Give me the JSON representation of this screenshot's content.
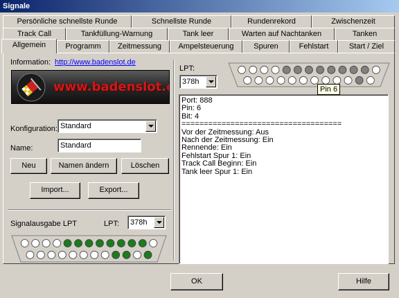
{
  "window": {
    "title": "Signale"
  },
  "tabs": {
    "row1": [
      "Persönliche schnellste Runde",
      "Schnellste Runde",
      "Rundenrekord",
      "Zwischenzeit"
    ],
    "row2": [
      "Track Call",
      "Tankfüllung-Warnung",
      "Tank leer",
      "Warten auf Nachtanken",
      "Tanken"
    ],
    "row3": [
      "Allgemein",
      "Programm",
      "Zeitmessung",
      "Ampelsteuerung",
      "Spuren",
      "Fehlstart",
      "Start / Ziel"
    ],
    "active": "Allgemein"
  },
  "info": {
    "label": "Information:",
    "url": "http://www.badenslot.de",
    "logo_text": "www.badenslot.de"
  },
  "konfiguration": {
    "label": "Konfiguration:",
    "value": "Standard"
  },
  "name": {
    "label": "Name:",
    "value": "Standard"
  },
  "buttons": {
    "neu": "Neu",
    "namen_aendern": "Namen ändern",
    "loeschen": "Löschen",
    "import": "Import...",
    "export": "Export...",
    "ok": "OK",
    "hilfe": "Hilfe"
  },
  "signalausgabe": {
    "label": "Signalausgabe LPT",
    "lpt_label": "LPT:",
    "lpt_value": "378h",
    "top_pins": [
      "off",
      "off",
      "off",
      "off",
      "on",
      "on",
      "on",
      "on",
      "on",
      "on",
      "on",
      "on",
      "off"
    ],
    "bottom_pins": [
      "off",
      "off",
      "off",
      "off",
      "off",
      "off",
      "off",
      "off",
      "on",
      "on",
      "off",
      "on"
    ],
    "on_color": "#1e7a1e",
    "off_color": "#ffffff"
  },
  "lpt_monitor": {
    "label": "LPT:",
    "value": "378h",
    "top_pins": [
      "off",
      "off",
      "off",
      "off",
      "on",
      "on",
      "on",
      "on",
      "on",
      "on",
      "on",
      "on",
      "off"
    ],
    "bottom_pins": [
      "off",
      "off",
      "off",
      "off",
      "off",
      "off",
      "off",
      "off",
      "off",
      "off",
      "on",
      "off"
    ],
    "on_color": "#808080",
    "off_color": "#ffffff",
    "tooltip": "Pin 6"
  },
  "log": {
    "lines": [
      "Port: 888",
      "Pin: 6",
      "Bit: 4",
      "====================================",
      "Vor der Zeitmessung: Aus",
      "Nach der Zeitmessung: Ein",
      "Rennende: Ein",
      "Fehlstart Spur 1: Ein",
      "Track Call Beginn: Ein",
      "Tank leer Spur 1: Ein"
    ]
  }
}
